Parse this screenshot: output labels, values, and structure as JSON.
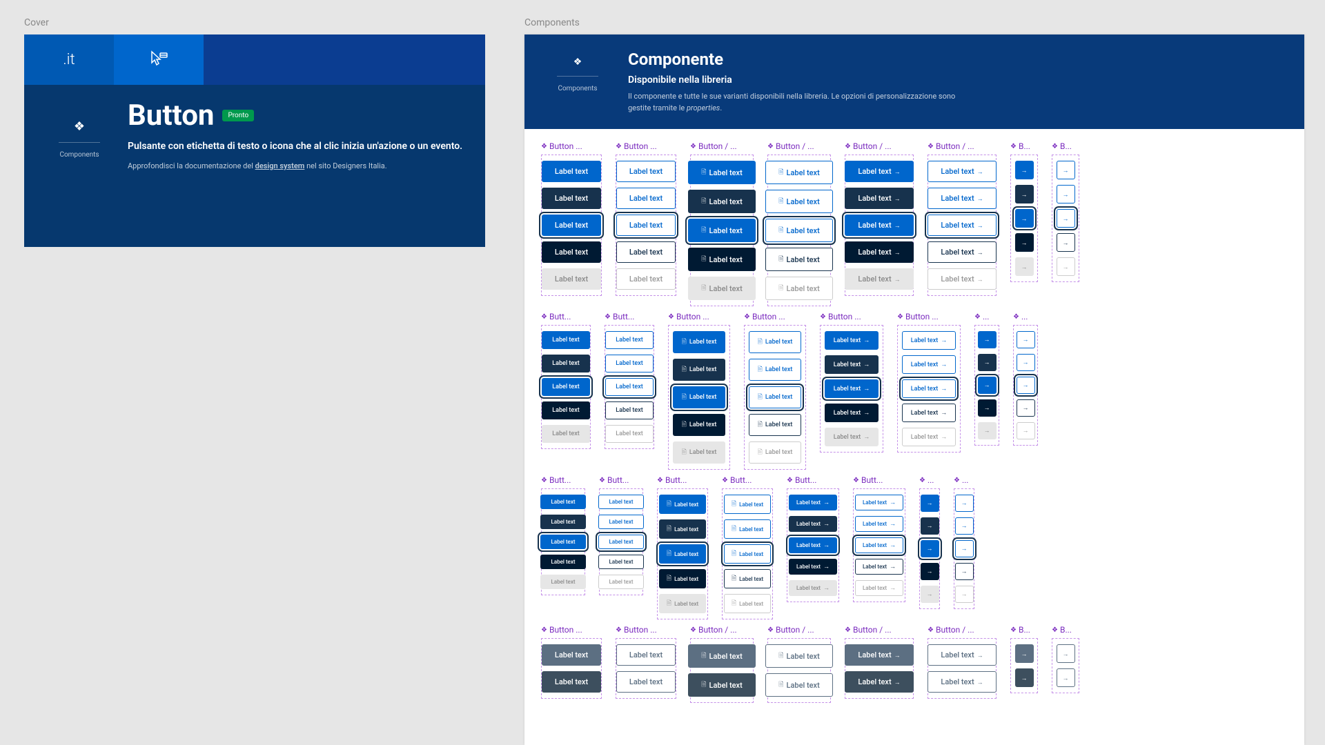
{
  "labels": {
    "cover": "Cover",
    "components": "Components",
    "sidebar": "Components"
  },
  "cover": {
    "logo": ".it",
    "title": "Button",
    "status": "Pronto",
    "subtitle": "Pulsante con etichetta di testo o icona che al clic inizia un'azione o un evento.",
    "desc_prefix": "Approfondisci la documentazione del ",
    "desc_link": "design system",
    "desc_suffix": " nel sito Designers Italia."
  },
  "components": {
    "title": "Componente",
    "subtitle": "Disponibile nella libreria",
    "desc_prefix": "Il componente e tutte le sue varianti disponibili nella libreria. Le opzioni di personalizzazione sono gestite tramite le ",
    "desc_italic": "properties",
    "desc_suffix": "."
  },
  "btn_label": "Label text",
  "row1_titles": [
    "Button ...",
    "Button ...",
    "Button / ...",
    "Button / ...",
    "Button / ...",
    "Button / ...",
    "B...",
    "B..."
  ],
  "row2_titles": [
    "Butt...",
    "Butt...",
    "Button ...",
    "Button ...",
    "Button ...",
    "Button ...",
    "...",
    "..."
  ],
  "row3_titles": [
    "Butt...",
    "Butt...",
    "Butt...",
    "Butt...",
    "Butt...",
    "Butt...",
    "...",
    "..."
  ],
  "row4_titles": [
    "Button ...",
    "Button ...",
    "Button / ...",
    "Button / ...",
    "Button / ...",
    "Button / ...",
    "B...",
    "B..."
  ]
}
